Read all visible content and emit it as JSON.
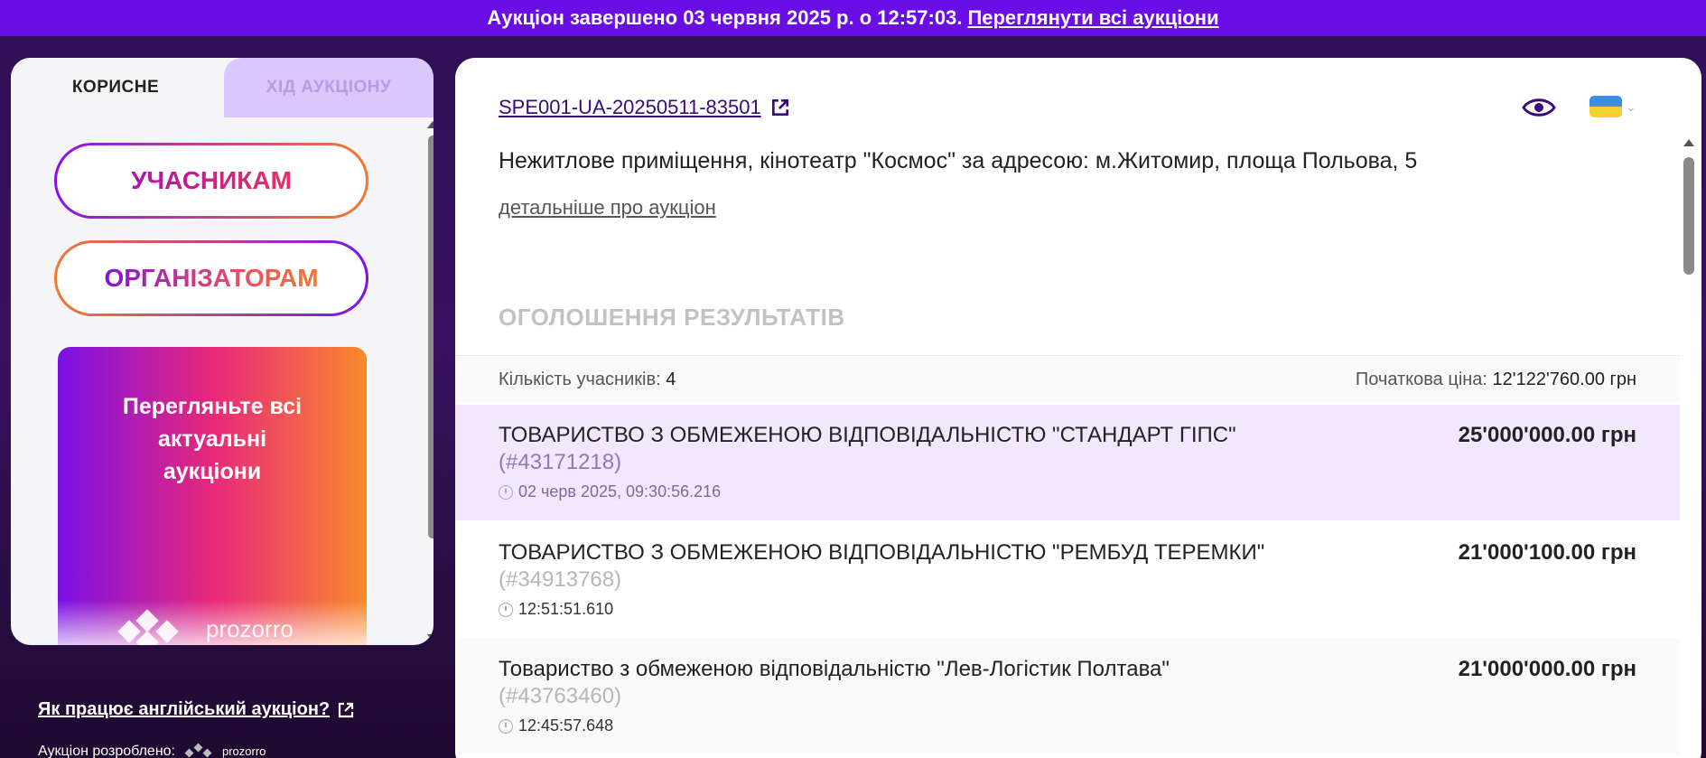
{
  "banner": {
    "text": "Аукціон завершено 03 червня 2025 р. о 12:57:03.",
    "link": "Переглянути всі аукціони"
  },
  "sidebar": {
    "tabs": [
      {
        "label": "КОРИСНЕ",
        "active": true
      },
      {
        "label": "ХІД АУКЦІОНУ",
        "active": false
      }
    ],
    "buttons": {
      "participants": "УЧАСНИКАМ",
      "organizers": "ОРГАНІЗАТОРАМ"
    },
    "promo": {
      "text_line1": "Перегляньте всі",
      "text_line2": "актуальні",
      "text_line3": "аукціони",
      "logo_text": "prozorro"
    },
    "how_link": "Як працює англійський аукціон?",
    "made_by_label": "Аукціон розроблено:",
    "made_by_logo": "prozorro"
  },
  "main": {
    "auction_id": "SPE001-UA-20250511-83501",
    "title": "Нежитлове приміщення, кінотеатр \"Космос\" за адресою: м.Житомир, площа Польова, 5",
    "details_link": "детальніше про аукціон",
    "section_title": "ОГОЛОШЕННЯ РЕЗУЛЬТАТІВ",
    "summary": {
      "participants_label": "Кількість учасників:",
      "participants_value": "4",
      "start_price_label": "Початкова ціна:",
      "start_price_value": "12'122'760.00 грн"
    },
    "bids": [
      {
        "name": "ТОВАРИСТВО З ОБМЕЖЕНОЮ ВІДПОВІДАЛЬНІСТЮ \"СТАНДАРТ ГІПС\"",
        "code": "(#43171218)",
        "time": "02 черв 2025, 09:30:56.216",
        "amount": "25'000'000.00 грн"
      },
      {
        "name": "ТОВАРИСТВО З ОБМЕЖЕНОЮ ВІДПОВІДАЛЬНІСТЮ \"РЕМБУД ТЕРЕМКИ\"",
        "code": "(#34913768)",
        "time": "12:51:51.610",
        "amount": "21'000'100.00 грн"
      },
      {
        "name": "Товариство з обмеженою відповідальністю \"Лев-Логістик Полтава\"",
        "code": "(#43763460)",
        "time": "12:45:57.648",
        "amount": "21'000'000.00 грн"
      }
    ]
  },
  "colors": {
    "banner": "#6a0ee6",
    "highlight_row": "#f1e8fd",
    "accent_purple": "#3a0a7a"
  }
}
